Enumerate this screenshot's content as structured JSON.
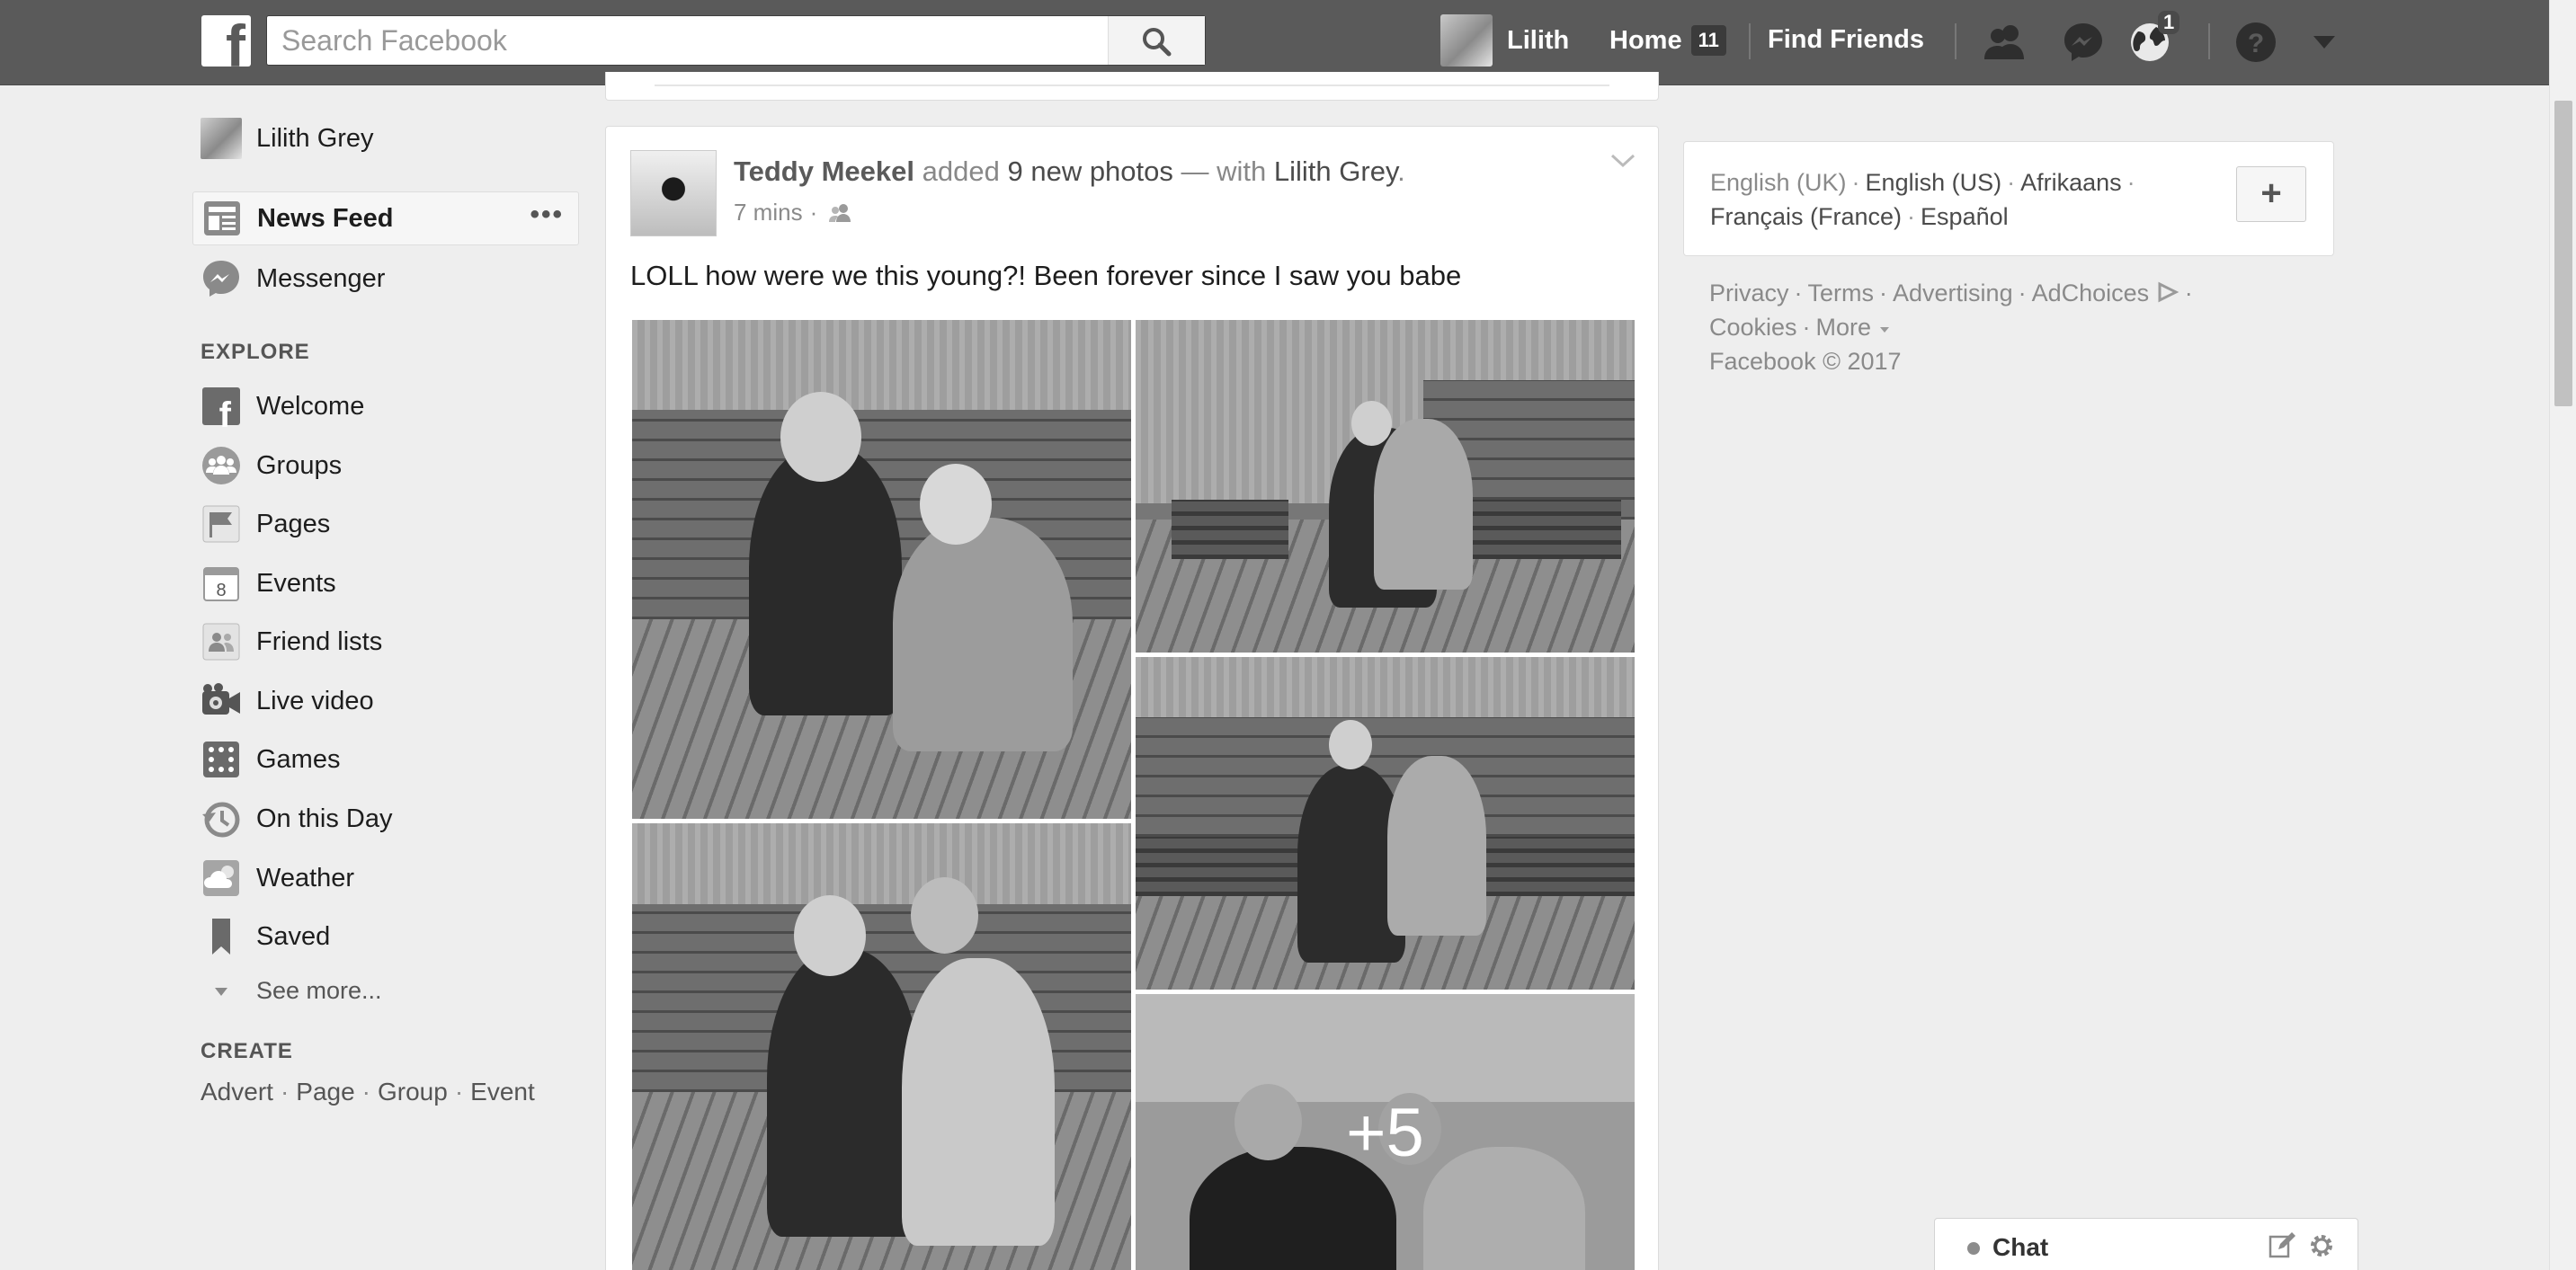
{
  "topbar": {
    "search_placeholder": "Search Facebook",
    "user_name": "Lilith",
    "home_label": "Home",
    "home_count": "11",
    "find_friends": "Find Friends",
    "notifications_count": "1"
  },
  "sidebar": {
    "profile_name": "Lilith Grey",
    "items": [
      {
        "label": "News Feed",
        "icon": "news-feed-icon"
      },
      {
        "label": "Messenger",
        "icon": "messenger-icon"
      }
    ],
    "explore_title": "EXPLORE",
    "explore": [
      {
        "label": "Welcome",
        "icon": "facebook-icon"
      },
      {
        "label": "Groups",
        "icon": "groups-icon"
      },
      {
        "label": "Pages",
        "icon": "flag-icon"
      },
      {
        "label": "Events",
        "icon": "calendar-icon",
        "badge": "8"
      },
      {
        "label": "Friend lists",
        "icon": "friend-list-icon"
      },
      {
        "label": "Live video",
        "icon": "video-camera-icon"
      },
      {
        "label": "Games",
        "icon": "games-icon"
      },
      {
        "label": "On this Day",
        "icon": "history-icon"
      },
      {
        "label": "Weather",
        "icon": "weather-icon"
      },
      {
        "label": "Saved",
        "icon": "bookmark-icon"
      }
    ],
    "see_more": "See more...",
    "create_title": "CREATE",
    "create_links": [
      "Advert",
      "Page",
      "Group",
      "Event"
    ]
  },
  "post": {
    "author": "Teddy Meekel",
    "action_added": "added",
    "photo_count": "9 new photos",
    "with_word": "— with",
    "tagged": "Lilith Grey",
    "period": ".",
    "time": "7 mins",
    "meta_sep": "·",
    "text": "LOLL how were we this young?! Been forever since I saw you babe",
    "more_photos": "+5"
  },
  "right": {
    "current_language": "English (UK)",
    "languages": [
      "English (US)",
      "Afrikaans",
      "Français (France)",
      "Español"
    ],
    "add_language": "+",
    "footer": [
      "Privacy",
      "Terms",
      "Advertising",
      "AdChoices",
      "Cookies",
      "More"
    ],
    "copyright": "Facebook © 2017"
  },
  "chat": {
    "label": "Chat"
  },
  "colors": {
    "topbar": "#5a5a5a",
    "page_bg": "#eeeeee"
  }
}
